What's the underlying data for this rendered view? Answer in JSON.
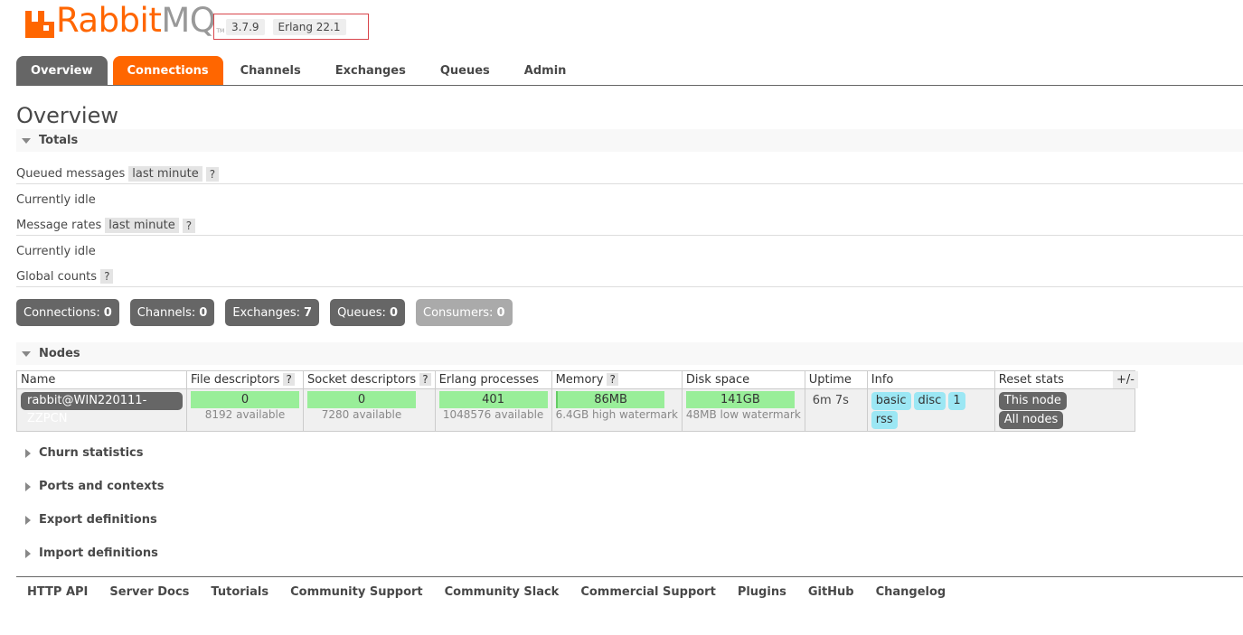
{
  "header": {
    "logo_rabbit": "Rabbit",
    "logo_mq": "MQ",
    "logo_tm": "TM",
    "version": "3.7.9",
    "erlang": "Erlang 22.1"
  },
  "tabs": [
    {
      "label": "Overview"
    },
    {
      "label": "Connections"
    },
    {
      "label": "Channels"
    },
    {
      "label": "Exchanges"
    },
    {
      "label": "Queues"
    },
    {
      "label": "Admin"
    }
  ],
  "page_title": "Overview",
  "totals": {
    "heading": "Totals",
    "queued_label": "Queued messages",
    "queued_range": "last minute",
    "queued_status": "Currently idle",
    "rates_label": "Message rates",
    "rates_range": "last minute",
    "rates_status": "Currently idle",
    "global_label": "Global counts",
    "help": "?"
  },
  "counts": [
    {
      "label": "Connections:",
      "value": "0"
    },
    {
      "label": "Channels:",
      "value": "0"
    },
    {
      "label": "Exchanges:",
      "value": "7"
    },
    {
      "label": "Queues:",
      "value": "0"
    },
    {
      "label": "Consumers:",
      "value": "0"
    }
  ],
  "nodes": {
    "heading": "Nodes",
    "columns": {
      "name": "Name",
      "file_descriptors": "File descriptors",
      "socket_descriptors": "Socket descriptors",
      "erlang_processes": "Erlang processes",
      "memory": "Memory",
      "disk_space": "Disk space",
      "uptime": "Uptime",
      "info": "Info",
      "reset_stats": "Reset stats"
    },
    "plus_minus": "+/-",
    "row": {
      "name": "rabbit@WIN220111-ZZPCN",
      "file_descriptors": "0",
      "file_descriptors_sub": "8192 available",
      "socket_descriptors": "0",
      "socket_descriptors_sub": "7280 available",
      "erlang_processes": "401",
      "erlang_processes_sub": "1048576 available",
      "memory": "86MB",
      "memory_sub": "6.4GB high watermark",
      "disk_space": "141GB",
      "disk_space_sub": "48MB low watermark",
      "uptime": "6m 7s",
      "info": [
        "basic",
        "disc",
        "1",
        "rss"
      ],
      "reset_this": "This node",
      "reset_all": "All nodes"
    }
  },
  "collapsed_sections": [
    {
      "label": "Churn statistics"
    },
    {
      "label": "Ports and contexts"
    },
    {
      "label": "Export definitions"
    },
    {
      "label": "Import definitions"
    }
  ],
  "footer": [
    {
      "label": "HTTP API"
    },
    {
      "label": "Server Docs"
    },
    {
      "label": "Tutorials"
    },
    {
      "label": "Community Support"
    },
    {
      "label": "Community Slack"
    },
    {
      "label": "Commercial Support"
    },
    {
      "label": "Plugins"
    },
    {
      "label": "GitHub"
    },
    {
      "label": "Changelog"
    }
  ],
  "colors": {
    "accent": "#ff6600",
    "tab_dark": "#666666",
    "meter_green": "#99ee99",
    "info_blue": "#9ce7f4"
  }
}
